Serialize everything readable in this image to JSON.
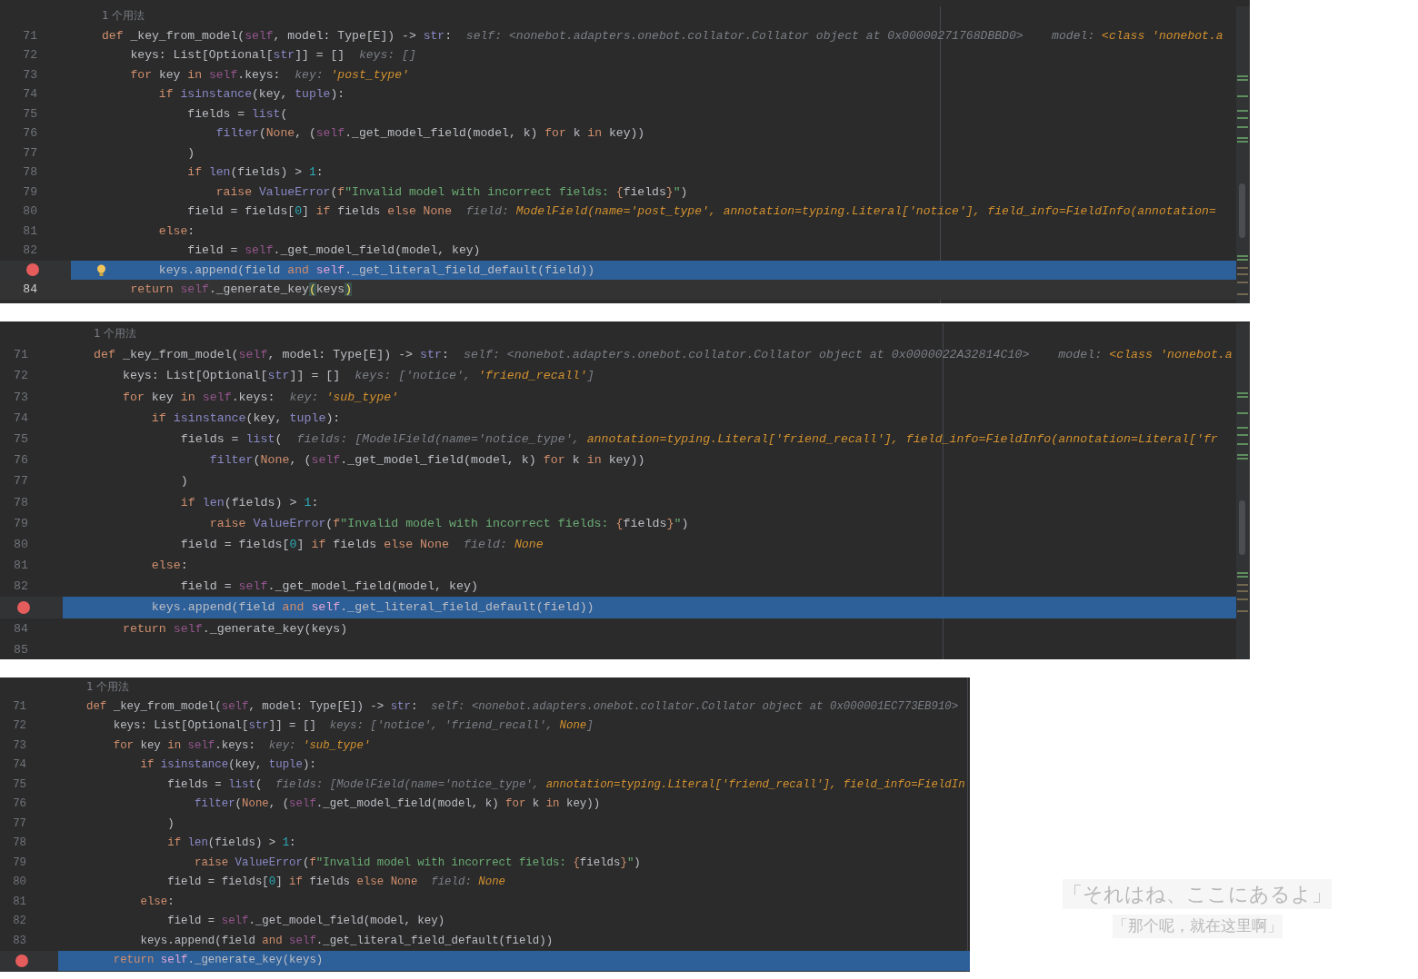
{
  "panels": [
    {
      "usage_hint": "1 个用法",
      "lines": [
        {
          "number": "71",
          "breakpoint": false,
          "current": false,
          "caret": false,
          "bulb": false,
          "tokens": [
            {
              "kind": "kw",
              "text": "def "
            },
            {
              "kind": "plain",
              "text": "_key_from_model("
            },
            {
              "kind": "self",
              "text": "self"
            },
            {
              "kind": "plain",
              "text": ", model: Type[E]) -> "
            },
            {
              "kind": "builtin",
              "text": "str"
            },
            {
              "kind": "plain",
              "text": ":"
            },
            {
              "kind": "hint",
              "text": "  self: <nonebot.adapters.onebot.collator.Collator object at 0x00000271768DBBD0>    model: "
            },
            {
              "kind": "hint_value",
              "text": "<class 'nonebot.a"
            }
          ]
        },
        {
          "number": "72",
          "breakpoint": false,
          "current": false,
          "caret": false,
          "bulb": false,
          "tokens": [
            {
              "kind": "plain",
              "text": "    keys: List[Optional["
            },
            {
              "kind": "builtin",
              "text": "str"
            },
            {
              "kind": "plain",
              "text": "]] = []"
            },
            {
              "kind": "hint",
              "text": "  keys: []"
            }
          ]
        },
        {
          "number": "73",
          "breakpoint": false,
          "current": false,
          "caret": false,
          "bulb": false,
          "tokens": [
            {
              "kind": "kw",
              "text": "    for "
            },
            {
              "kind": "plain",
              "text": "key "
            },
            {
              "kind": "kw",
              "text": "in "
            },
            {
              "kind": "self",
              "text": "self"
            },
            {
              "kind": "plain",
              "text": ".keys:"
            },
            {
              "kind": "hint",
              "text": "  key: "
            },
            {
              "kind": "hint_value",
              "text": "'post_type'"
            }
          ]
        },
        {
          "number": "74",
          "breakpoint": false,
          "current": false,
          "caret": false,
          "bulb": false,
          "tokens": [
            {
              "kind": "kw",
              "text": "        if "
            },
            {
              "kind": "builtin",
              "text": "isinstance"
            },
            {
              "kind": "plain",
              "text": "(key, "
            },
            {
              "kind": "builtin",
              "text": "tuple"
            },
            {
              "kind": "plain",
              "text": "):"
            }
          ]
        },
        {
          "number": "75",
          "breakpoint": false,
          "current": false,
          "caret": false,
          "bulb": false,
          "tokens": [
            {
              "kind": "plain",
              "text": "            fields = "
            },
            {
              "kind": "builtin",
              "text": "list"
            },
            {
              "kind": "plain",
              "text": "("
            }
          ]
        },
        {
          "number": "76",
          "breakpoint": false,
          "current": false,
          "caret": false,
          "bulb": false,
          "tokens": [
            {
              "kind": "builtin",
              "text": "                filter"
            },
            {
              "kind": "plain",
              "text": "("
            },
            {
              "kind": "kw",
              "text": "None"
            },
            {
              "kind": "plain",
              "text": ", ("
            },
            {
              "kind": "self",
              "text": "self"
            },
            {
              "kind": "plain",
              "text": "._get_model_field(model, k) "
            },
            {
              "kind": "kw",
              "text": "for "
            },
            {
              "kind": "plain",
              "text": "k "
            },
            {
              "kind": "kw",
              "text": "in "
            },
            {
              "kind": "plain",
              "text": "key))"
            }
          ]
        },
        {
          "number": "77",
          "breakpoint": false,
          "current": false,
          "caret": false,
          "bulb": false,
          "tokens": [
            {
              "kind": "plain",
              "text": "            )"
            }
          ]
        },
        {
          "number": "78",
          "breakpoint": false,
          "current": false,
          "caret": false,
          "bulb": false,
          "tokens": [
            {
              "kind": "kw",
              "text": "            if "
            },
            {
              "kind": "builtin",
              "text": "len"
            },
            {
              "kind": "plain",
              "text": "(fields) > "
            },
            {
              "kind": "number",
              "text": "1"
            },
            {
              "kind": "plain",
              "text": ":"
            }
          ]
        },
        {
          "number": "79",
          "breakpoint": false,
          "current": false,
          "caret": false,
          "bulb": false,
          "tokens": [
            {
              "kind": "kw",
              "text": "                raise "
            },
            {
              "kind": "builtin",
              "text": "ValueError"
            },
            {
              "kind": "plain",
              "text": "("
            },
            {
              "kind": "kw",
              "text": "f"
            },
            {
              "kind": "string",
              "text": "\"Invalid model with incorrect fields: "
            },
            {
              "kind": "kw",
              "text": "{"
            },
            {
              "kind": "plain",
              "text": "fields"
            },
            {
              "kind": "kw",
              "text": "}"
            },
            {
              "kind": "string",
              "text": "\""
            },
            {
              "kind": "plain",
              "text": ")"
            }
          ]
        },
        {
          "number": "80",
          "breakpoint": false,
          "current": false,
          "caret": false,
          "bulb": false,
          "tokens": [
            {
              "kind": "plain",
              "text": "            field = fields["
            },
            {
              "kind": "number",
              "text": "0"
            },
            {
              "kind": "plain",
              "text": "] "
            },
            {
              "kind": "kw",
              "text": "if "
            },
            {
              "kind": "plain",
              "text": "fields "
            },
            {
              "kind": "kw",
              "text": "else None"
            },
            {
              "kind": "hint",
              "text": "  field: "
            },
            {
              "kind": "hint_value",
              "text": "ModelField(name='post_type', annotation=typing.Literal['notice'], field_info=FieldInfo(annotation="
            }
          ]
        },
        {
          "number": "81",
          "breakpoint": false,
          "current": false,
          "caret": false,
          "bulb": false,
          "tokens": [
            {
              "kind": "kw",
              "text": "        else"
            },
            {
              "kind": "plain",
              "text": ":"
            }
          ]
        },
        {
          "number": "82",
          "breakpoint": false,
          "current": false,
          "caret": false,
          "bulb": false,
          "tokens": [
            {
              "kind": "plain",
              "text": "            field = "
            },
            {
              "kind": "self",
              "text": "self"
            },
            {
              "kind": "plain",
              "text": "._get_model_field(model, key)"
            }
          ]
        },
        {
          "breakpoint": true,
          "current": true,
          "caret": false,
          "bulb": true,
          "tokens": [
            {
              "kind": "plain",
              "text": "        keys.append(field "
            },
            {
              "kind": "kw",
              "text": "and "
            },
            {
              "kind": "self",
              "text": "self"
            },
            {
              "kind": "plain",
              "text": "._get_literal_field_default(field))"
            }
          ]
        },
        {
          "number": "84",
          "breakpoint": false,
          "current": false,
          "caret": true,
          "bulb": false,
          "tokens": [
            {
              "kind": "kw",
              "text": "    return "
            },
            {
              "kind": "self",
              "text": "self"
            },
            {
              "kind": "plain",
              "text": "._generate_key"
            },
            {
              "kind": "paren_match",
              "text": "("
            },
            {
              "kind": "plain",
              "text": "keys"
            },
            {
              "kind": "paren_match",
              "text": ")"
            }
          ]
        }
      ]
    },
    {
      "usage_hint": "1 个用法",
      "lines": [
        {
          "number": "71",
          "breakpoint": false,
          "current": false,
          "caret": false,
          "bulb": false,
          "tokens": [
            {
              "kind": "kw",
              "text": "def "
            },
            {
              "kind": "plain",
              "text": "_key_from_model("
            },
            {
              "kind": "self",
              "text": "self"
            },
            {
              "kind": "plain",
              "text": ", model: Type[E]) -> "
            },
            {
              "kind": "builtin",
              "text": "str"
            },
            {
              "kind": "plain",
              "text": ":"
            },
            {
              "kind": "hint",
              "text": "  self: <nonebot.adapters.onebot.collator.Collator object at 0x0000022A32814C10>    model: "
            },
            {
              "kind": "hint_value",
              "text": "<class 'nonebot.a"
            }
          ]
        },
        {
          "number": "72",
          "breakpoint": false,
          "current": false,
          "caret": false,
          "bulb": false,
          "tokens": [
            {
              "kind": "plain",
              "text": "    keys: List[Optional["
            },
            {
              "kind": "builtin",
              "text": "str"
            },
            {
              "kind": "plain",
              "text": "]] = []"
            },
            {
              "kind": "hint",
              "text": "  keys: ['notice', "
            },
            {
              "kind": "hint_value",
              "text": "'friend_recall'"
            },
            {
              "kind": "hint",
              "text": "]"
            }
          ]
        },
        {
          "number": "73",
          "breakpoint": false,
          "current": false,
          "caret": false,
          "bulb": false,
          "tokens": [
            {
              "kind": "kw",
              "text": "    for "
            },
            {
              "kind": "plain",
              "text": "key "
            },
            {
              "kind": "kw",
              "text": "in "
            },
            {
              "kind": "self",
              "text": "self"
            },
            {
              "kind": "plain",
              "text": ".keys:"
            },
            {
              "kind": "hint",
              "text": "  key: "
            },
            {
              "kind": "hint_value",
              "text": "'sub_type'"
            }
          ]
        },
        {
          "number": "74",
          "breakpoint": false,
          "current": false,
          "caret": false,
          "bulb": false,
          "tokens": [
            {
              "kind": "kw",
              "text": "        if "
            },
            {
              "kind": "builtin",
              "text": "isinstance"
            },
            {
              "kind": "plain",
              "text": "(key, "
            },
            {
              "kind": "builtin",
              "text": "tuple"
            },
            {
              "kind": "plain",
              "text": "):"
            }
          ]
        },
        {
          "number": "75",
          "breakpoint": false,
          "current": false,
          "caret": false,
          "bulb": false,
          "tokens": [
            {
              "kind": "plain",
              "text": "            fields = "
            },
            {
              "kind": "builtin",
              "text": "list"
            },
            {
              "kind": "plain",
              "text": "("
            },
            {
              "kind": "hint",
              "text": "  fields: [ModelField(name='notice_type', "
            },
            {
              "kind": "hint_value",
              "text": "annotation=typing.Literal['friend_recall'], field_info=FieldInfo(annotation=Literal['fr"
            }
          ]
        },
        {
          "number": "76",
          "breakpoint": false,
          "current": false,
          "caret": false,
          "bulb": false,
          "tokens": [
            {
              "kind": "builtin",
              "text": "                filter"
            },
            {
              "kind": "plain",
              "text": "("
            },
            {
              "kind": "kw",
              "text": "None"
            },
            {
              "kind": "plain",
              "text": ", ("
            },
            {
              "kind": "self",
              "text": "self"
            },
            {
              "kind": "plain",
              "text": "._get_model_field(model, k) "
            },
            {
              "kind": "kw",
              "text": "for "
            },
            {
              "kind": "plain",
              "text": "k "
            },
            {
              "kind": "kw",
              "text": "in "
            },
            {
              "kind": "plain",
              "text": "key))"
            }
          ]
        },
        {
          "number": "77",
          "breakpoint": false,
          "current": false,
          "caret": false,
          "bulb": false,
          "tokens": [
            {
              "kind": "plain",
              "text": "            )"
            }
          ]
        },
        {
          "number": "78",
          "breakpoint": false,
          "current": false,
          "caret": false,
          "bulb": false,
          "tokens": [
            {
              "kind": "kw",
              "text": "            if "
            },
            {
              "kind": "builtin",
              "text": "len"
            },
            {
              "kind": "plain",
              "text": "(fields) > "
            },
            {
              "kind": "number",
              "text": "1"
            },
            {
              "kind": "plain",
              "text": ":"
            }
          ]
        },
        {
          "number": "79",
          "breakpoint": false,
          "current": false,
          "caret": false,
          "bulb": false,
          "tokens": [
            {
              "kind": "kw",
              "text": "                raise "
            },
            {
              "kind": "builtin",
              "text": "ValueError"
            },
            {
              "kind": "plain",
              "text": "("
            },
            {
              "kind": "kw",
              "text": "f"
            },
            {
              "kind": "string",
              "text": "\"Invalid model with incorrect fields: "
            },
            {
              "kind": "kw",
              "text": "{"
            },
            {
              "kind": "plain",
              "text": "fields"
            },
            {
              "kind": "kw",
              "text": "}"
            },
            {
              "kind": "string",
              "text": "\""
            },
            {
              "kind": "plain",
              "text": ")"
            }
          ]
        },
        {
          "number": "80",
          "breakpoint": false,
          "current": false,
          "caret": false,
          "bulb": false,
          "tokens": [
            {
              "kind": "plain",
              "text": "            field = fields["
            },
            {
              "kind": "number",
              "text": "0"
            },
            {
              "kind": "plain",
              "text": "] "
            },
            {
              "kind": "kw",
              "text": "if "
            },
            {
              "kind": "plain",
              "text": "fields "
            },
            {
              "kind": "kw",
              "text": "else None"
            },
            {
              "kind": "hint",
              "text": "  field: "
            },
            {
              "kind": "hint_value",
              "text": "None"
            }
          ]
        },
        {
          "number": "81",
          "breakpoint": false,
          "current": false,
          "caret": false,
          "bulb": false,
          "tokens": [
            {
              "kind": "kw",
              "text": "        else"
            },
            {
              "kind": "plain",
              "text": ":"
            }
          ]
        },
        {
          "number": "82",
          "breakpoint": false,
          "current": false,
          "caret": false,
          "bulb": false,
          "tokens": [
            {
              "kind": "plain",
              "text": "            field = "
            },
            {
              "kind": "self",
              "text": "self"
            },
            {
              "kind": "plain",
              "text": "._get_model_field(model, key)"
            }
          ]
        },
        {
          "breakpoint": true,
          "current": true,
          "caret": false,
          "bulb": false,
          "tokens": [
            {
              "kind": "plain",
              "text": "        keys.append(field "
            },
            {
              "kind": "kw",
              "text": "and "
            },
            {
              "kind": "self",
              "text": "self"
            },
            {
              "kind": "plain",
              "text": "._get_literal_field_default(field))"
            }
          ]
        },
        {
          "number": "84",
          "breakpoint": false,
          "current": false,
          "caret": false,
          "bulb": false,
          "tokens": [
            {
              "kind": "kw",
              "text": "    return "
            },
            {
              "kind": "self",
              "text": "self"
            },
            {
              "kind": "plain",
              "text": "._generate_key(keys)"
            }
          ]
        },
        {
          "number": "85",
          "breakpoint": false,
          "current": false,
          "caret": false,
          "bulb": false
        }
      ]
    },
    {
      "usage_hint": "1 个用法",
      "lines": [
        {
          "number": "71",
          "breakpoint": false,
          "current": false,
          "caret": false,
          "bulb": false,
          "tokens": [
            {
              "kind": "kw",
              "text": "def "
            },
            {
              "kind": "plain",
              "text": "_key_from_model("
            },
            {
              "kind": "self",
              "text": "self"
            },
            {
              "kind": "plain",
              "text": ", model: Type[E]) -> "
            },
            {
              "kind": "builtin",
              "text": "str"
            },
            {
              "kind": "plain",
              "text": ":"
            },
            {
              "kind": "hint",
              "text": "  self: <nonebot.adapters.onebot.collator.Collator object at 0x000001EC773EB910>"
            }
          ]
        },
        {
          "number": "72",
          "breakpoint": false,
          "current": false,
          "caret": false,
          "bulb": false,
          "tokens": [
            {
              "kind": "plain",
              "text": "    keys: List[Optional["
            },
            {
              "kind": "builtin",
              "text": "str"
            },
            {
              "kind": "plain",
              "text": "]] = []"
            },
            {
              "kind": "hint",
              "text": "  keys: ['notice', 'friend_recall', "
            },
            {
              "kind": "hint_value",
              "text": "None"
            },
            {
              "kind": "hint",
              "text": "]"
            }
          ]
        },
        {
          "number": "73",
          "breakpoint": false,
          "current": false,
          "caret": false,
          "bulb": false,
          "tokens": [
            {
              "kind": "kw",
              "text": "    for "
            },
            {
              "kind": "plain",
              "text": "key "
            },
            {
              "kind": "kw",
              "text": "in "
            },
            {
              "kind": "self",
              "text": "self"
            },
            {
              "kind": "plain",
              "text": ".keys:"
            },
            {
              "kind": "hint",
              "text": "  key: "
            },
            {
              "kind": "hint_value",
              "text": "'sub_type'"
            }
          ]
        },
        {
          "number": "74",
          "breakpoint": false,
          "current": false,
          "caret": false,
          "bulb": false,
          "tokens": [
            {
              "kind": "kw",
              "text": "        if "
            },
            {
              "kind": "builtin",
              "text": "isinstance"
            },
            {
              "kind": "plain",
              "text": "(key, "
            },
            {
              "kind": "builtin",
              "text": "tuple"
            },
            {
              "kind": "plain",
              "text": "):"
            }
          ]
        },
        {
          "number": "75",
          "breakpoint": false,
          "current": false,
          "caret": false,
          "bulb": false,
          "tokens": [
            {
              "kind": "plain",
              "text": "            fields = "
            },
            {
              "kind": "builtin",
              "text": "list"
            },
            {
              "kind": "plain",
              "text": "("
            },
            {
              "kind": "hint",
              "text": "  fields: [ModelField(name='notice_type', "
            },
            {
              "kind": "hint_value",
              "text": "annotation=typing.Literal['friend_recall'], field_info=FieldIn"
            }
          ]
        },
        {
          "number": "76",
          "breakpoint": false,
          "current": false,
          "caret": false,
          "bulb": false,
          "tokens": [
            {
              "kind": "builtin",
              "text": "                filter"
            },
            {
              "kind": "plain",
              "text": "("
            },
            {
              "kind": "kw",
              "text": "None"
            },
            {
              "kind": "plain",
              "text": ", ("
            },
            {
              "kind": "self",
              "text": "self"
            },
            {
              "kind": "plain",
              "text": "._get_model_field(model, k) "
            },
            {
              "kind": "kw",
              "text": "for "
            },
            {
              "kind": "plain",
              "text": "k "
            },
            {
              "kind": "kw",
              "text": "in "
            },
            {
              "kind": "plain",
              "text": "key))"
            }
          ]
        },
        {
          "number": "77",
          "breakpoint": false,
          "current": false,
          "caret": false,
          "bulb": false,
          "tokens": [
            {
              "kind": "plain",
              "text": "            )"
            }
          ]
        },
        {
          "number": "78",
          "breakpoint": false,
          "current": false,
          "caret": false,
          "bulb": false,
          "tokens": [
            {
              "kind": "kw",
              "text": "            if "
            },
            {
              "kind": "builtin",
              "text": "len"
            },
            {
              "kind": "plain",
              "text": "(fields) > "
            },
            {
              "kind": "number",
              "text": "1"
            },
            {
              "kind": "plain",
              "text": ":"
            }
          ]
        },
        {
          "number": "79",
          "breakpoint": false,
          "current": false,
          "caret": false,
          "bulb": false,
          "tokens": [
            {
              "kind": "kw",
              "text": "                raise "
            },
            {
              "kind": "builtin",
              "text": "ValueError"
            },
            {
              "kind": "plain",
              "text": "("
            },
            {
              "kind": "kw",
              "text": "f"
            },
            {
              "kind": "string",
              "text": "\"Invalid model with incorrect fields: "
            },
            {
              "kind": "kw",
              "text": "{"
            },
            {
              "kind": "plain",
              "text": "fields"
            },
            {
              "kind": "kw",
              "text": "}"
            },
            {
              "kind": "string",
              "text": "\""
            },
            {
              "kind": "plain",
              "text": ")"
            }
          ]
        },
        {
          "number": "80",
          "breakpoint": false,
          "current": false,
          "caret": false,
          "bulb": false,
          "tokens": [
            {
              "kind": "plain",
              "text": "            field = fields["
            },
            {
              "kind": "number",
              "text": "0"
            },
            {
              "kind": "plain",
              "text": "] "
            },
            {
              "kind": "kw",
              "text": "if "
            },
            {
              "kind": "plain",
              "text": "fields "
            },
            {
              "kind": "kw",
              "text": "else None"
            },
            {
              "kind": "hint",
              "text": "  field: "
            },
            {
              "kind": "hint_value",
              "text": "None"
            }
          ]
        },
        {
          "number": "81",
          "breakpoint": false,
          "current": false,
          "caret": false,
          "bulb": false,
          "tokens": [
            {
              "kind": "kw",
              "text": "        else"
            },
            {
              "kind": "plain",
              "text": ":"
            }
          ]
        },
        {
          "number": "82",
          "breakpoint": false,
          "current": false,
          "caret": false,
          "bulb": false,
          "tokens": [
            {
              "kind": "plain",
              "text": "            field = "
            },
            {
              "kind": "self",
              "text": "self"
            },
            {
              "kind": "plain",
              "text": "._get_model_field(model, key)"
            }
          ]
        },
        {
          "number": "83",
          "breakpoint": false,
          "current": false,
          "caret": false,
          "bulb": false,
          "tokens": [
            {
              "kind": "plain",
              "text": "        keys.append(field "
            },
            {
              "kind": "kw",
              "text": "and "
            },
            {
              "kind": "self",
              "text": "self"
            },
            {
              "kind": "plain",
              "text": "._get_literal_field_default(field))"
            }
          ]
        },
        {
          "breakpoint": true,
          "current": true,
          "caret": false,
          "bulb": false,
          "tokens": [
            {
              "kind": "kw",
              "text": "    return "
            },
            {
              "kind": "self",
              "text": "self"
            },
            {
              "kind": "plain",
              "text": "._generate_key(keys)"
            }
          ]
        }
      ]
    }
  ],
  "caption": [
    "「それはね、ここにあるよ」",
    "「那个呢，就在这里啊」"
  ]
}
